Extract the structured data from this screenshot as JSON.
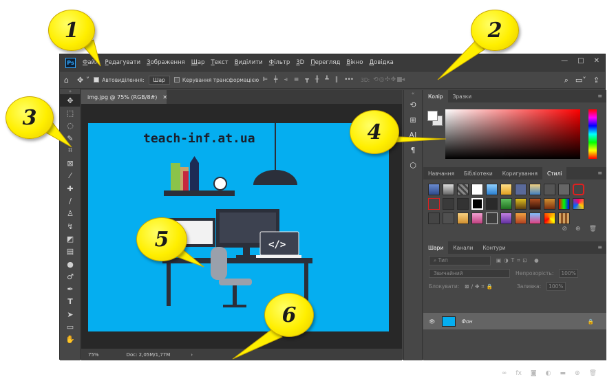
{
  "menu": {
    "logo": "Ps",
    "items": [
      "Файл",
      "Редагувати",
      "Зображення",
      "Шар",
      "Текст",
      "Виділити",
      "Фільтр",
      "3D",
      "Перегляд",
      "Вікно",
      "Довідка"
    ]
  },
  "window_controls": [
    "—",
    "□",
    "✕"
  ],
  "options": {
    "auto_select_label": "Автовиділення:",
    "auto_select_value": "Шар",
    "transform_label": "Керування трансформацією",
    "three_d_label": "3D:"
  },
  "document": {
    "tab_title": "img.jpg @ 75% (RGB/8#)",
    "tab_close": "✕",
    "canvas_text": "teach-inf.at.ua",
    "zoom": "75%",
    "doc_info": "Doc: 2,05M/1,77M",
    "status_arrow": "›"
  },
  "color_panel": {
    "tabs": [
      "Колір",
      "Зразки"
    ]
  },
  "styles_panel": {
    "tabs": [
      "Навчання",
      "Бібліотеки",
      "Коригування",
      "Стилі"
    ]
  },
  "layers_panel": {
    "tabs": [
      "Шари",
      "Канали",
      "Контури"
    ],
    "filter_placeholder": "Тип",
    "blend_mode": "Звичайний",
    "opacity_label": "Непрозорість:",
    "opacity_value": "100%",
    "lock_label": "Блокувати:",
    "fill_label": "Заливка:",
    "fill_value": "100%",
    "layer_name": "Фон",
    "layer_footer": [
      "fx"
    ]
  },
  "callouts": [
    "1",
    "2",
    "3",
    "4",
    "5",
    "6"
  ],
  "colors": {
    "canvas": "#05aef0",
    "callout_fill": "#ffef00",
    "accent": "#31a8ff"
  }
}
